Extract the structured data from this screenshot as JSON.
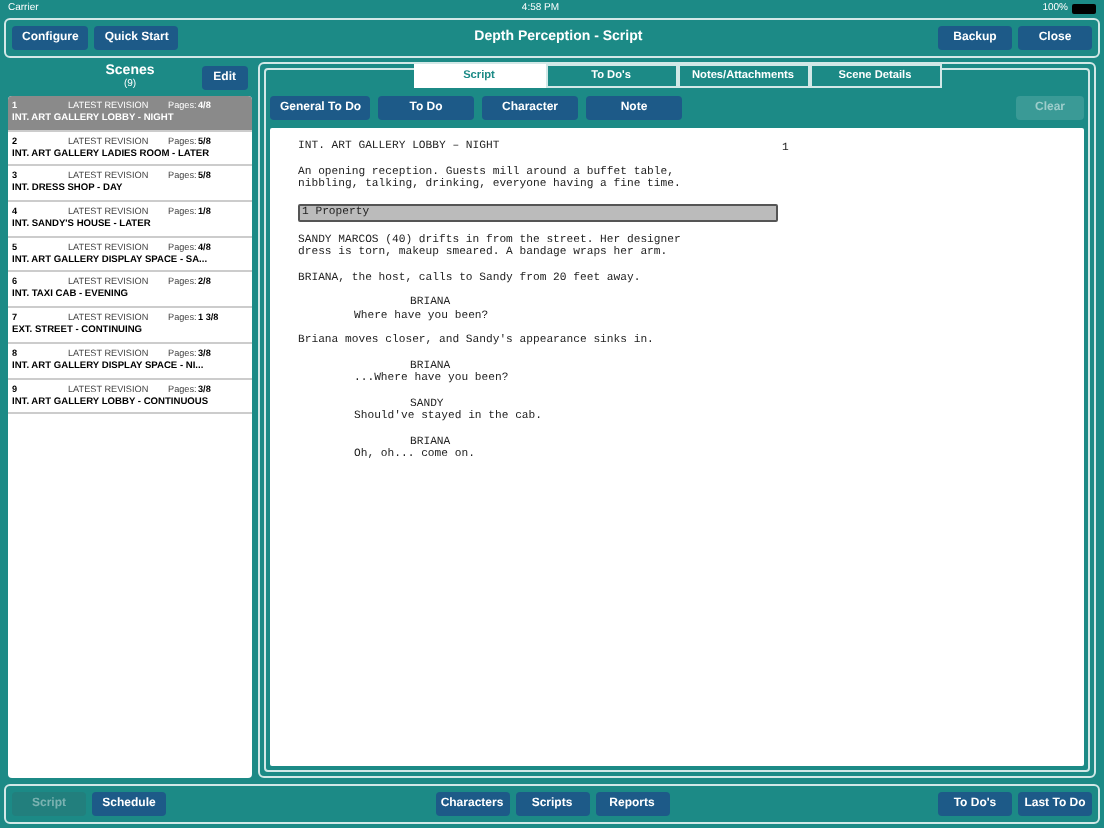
{
  "status_bar": {
    "carrier": "Carrier",
    "time": "4:58 PM",
    "battery": "100%"
  },
  "top_bar": {
    "left_buttons": [
      "Configure",
      "Quick Start"
    ],
    "title": "Depth Perception - Script",
    "right_buttons": [
      "Backup",
      "Close"
    ]
  },
  "scenes": {
    "title": "Scenes",
    "count": "(9)",
    "edit": "Edit",
    "items": [
      {
        "number": "1",
        "revision": "LATEST REVISION",
        "pages_label": "Pages:",
        "pages": "4/8",
        "heading": "INT. ART GALLERY LOBBY - NIGHT",
        "selected": true
      },
      {
        "number": "2",
        "revision": "LATEST REVISION",
        "pages_label": "Pages:",
        "pages": "5/8",
        "heading": "INT. ART GALLERY LADIES ROOM - LATER",
        "selected": false
      },
      {
        "number": "3",
        "revision": "LATEST REVISION",
        "pages_label": "Pages:",
        "pages": "5/8",
        "heading": "INT. DRESS SHOP - DAY",
        "selected": false
      },
      {
        "number": "4",
        "revision": "LATEST REVISION",
        "pages_label": "Pages:",
        "pages": "1/8",
        "heading": "INT. SANDY'S HOUSE - LATER",
        "selected": false
      },
      {
        "number": "5",
        "revision": "LATEST REVISION",
        "pages_label": "Pages:",
        "pages": "4/8",
        "heading": "INT. ART GALLERY DISPLAY SPACE - SA...",
        "selected": false
      },
      {
        "number": "6",
        "revision": "LATEST REVISION",
        "pages_label": "Pages:",
        "pages": "2/8",
        "heading": "INT. TAXI CAB - EVENING",
        "selected": false
      },
      {
        "number": "7",
        "revision": "LATEST REVISION",
        "pages_label": "Pages:",
        "pages": "1 3/8",
        "heading": "EXT. STREET - CONTINUING",
        "selected": false
      },
      {
        "number": "8",
        "revision": "LATEST REVISION",
        "pages_label": "Pages:",
        "pages": "3/8",
        "heading": "INT. ART GALLERY DISPLAY SPACE - NI...",
        "selected": false
      },
      {
        "number": "9",
        "revision": "LATEST REVISION",
        "pages_label": "Pages:",
        "pages": "3/8",
        "heading": "INT. ART GALLERY LOBBY - CONTINUOUS",
        "selected": false
      }
    ]
  },
  "tabs": [
    {
      "label": "Script",
      "selected": true
    },
    {
      "label": "To Do's",
      "selected": false
    },
    {
      "label": "Notes/Attachments",
      "selected": false
    },
    {
      "label": "Scene Details",
      "selected": false
    }
  ],
  "toolbar": {
    "buttons": [
      "General To Do",
      "To Do",
      "Character",
      "Note"
    ],
    "clear": {
      "label": "Clear",
      "disabled": true
    }
  },
  "script": {
    "page_number": "1",
    "lines": [
      {
        "kind": "heading",
        "text": "INT. ART GALLERY LOBBY – NIGHT"
      },
      {
        "kind": "action",
        "text": "An opening reception. Guests mill around a buffet table,\nnibbling, talking, drinking, everyone having a fine time."
      },
      {
        "kind": "tag",
        "text": "1 Property"
      },
      {
        "kind": "action",
        "text": "SANDY MARCOS (40) drifts in from the street. Her designer\ndress is torn, makeup smeared. A bandage wraps her arm."
      },
      {
        "kind": "action",
        "text": "BRIANA, the host, calls to Sandy from 20 feet away."
      },
      {
        "kind": "character",
        "text": "BRIANA"
      },
      {
        "kind": "dialogue",
        "text": "Where have you been?"
      },
      {
        "kind": "action",
        "text": "Briana moves closer, and Sandy's appearance sinks in."
      },
      {
        "kind": "character",
        "text": "BRIANA"
      },
      {
        "kind": "dialogue",
        "text": "...Where have you been?"
      },
      {
        "kind": "character",
        "text": "SANDY"
      },
      {
        "kind": "dialogue",
        "text": "Should've stayed in the cab."
      },
      {
        "kind": "character",
        "text": "BRIANA"
      },
      {
        "kind": "dialogue",
        "text": "Oh, oh... come on."
      }
    ]
  },
  "bottom_bar": {
    "left": [
      {
        "label": "Script",
        "disabled": true
      },
      {
        "label": "Schedule",
        "disabled": false
      }
    ],
    "center": [
      {
        "label": "Characters",
        "disabled": false
      },
      {
        "label": "Scripts",
        "disabled": false
      },
      {
        "label": "Reports",
        "disabled": false
      }
    ],
    "right": [
      {
        "label": "To Do's",
        "disabled": false
      },
      {
        "label": "Last To Do",
        "disabled": false
      }
    ]
  }
}
